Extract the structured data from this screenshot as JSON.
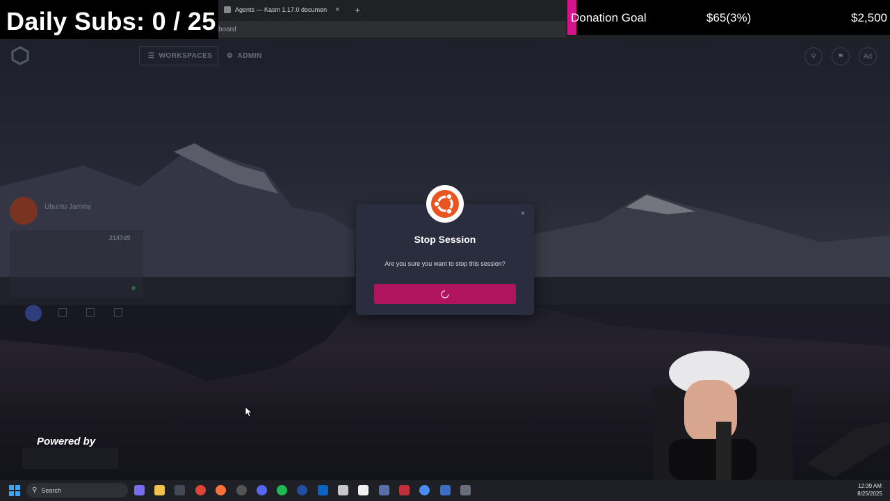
{
  "overlay": {
    "daily_subs": "Daily Subs: 0 / 25",
    "donation_label": "Donation Goal",
    "donation_amount": "$65(3%)",
    "donation_target": "$2,500",
    "powered_by": "Powered by"
  },
  "browser": {
    "tab_title": "Agents — Kasm 1.17.0 documen",
    "new_tab": "+",
    "close_tab": "×",
    "address": "board"
  },
  "kasm_nav": {
    "workspaces_label": "WORKSPACES",
    "admin_label": "ADMIN",
    "avatar_initials": "Ad"
  },
  "session_card": {
    "name": "Ubuntu Jammy",
    "session_id": "2147d5"
  },
  "modal": {
    "title": "Stop Session",
    "message": "Are you sure you want to stop this session?",
    "close": "×"
  },
  "taskbar": {
    "search_placeholder": "Search",
    "time": "12:39 AM",
    "date": "8/25/2025"
  },
  "colors": {
    "donation_accent": "#d4148a",
    "modal_button": "#b0145f",
    "ubuntu_orange": "#e95420"
  }
}
